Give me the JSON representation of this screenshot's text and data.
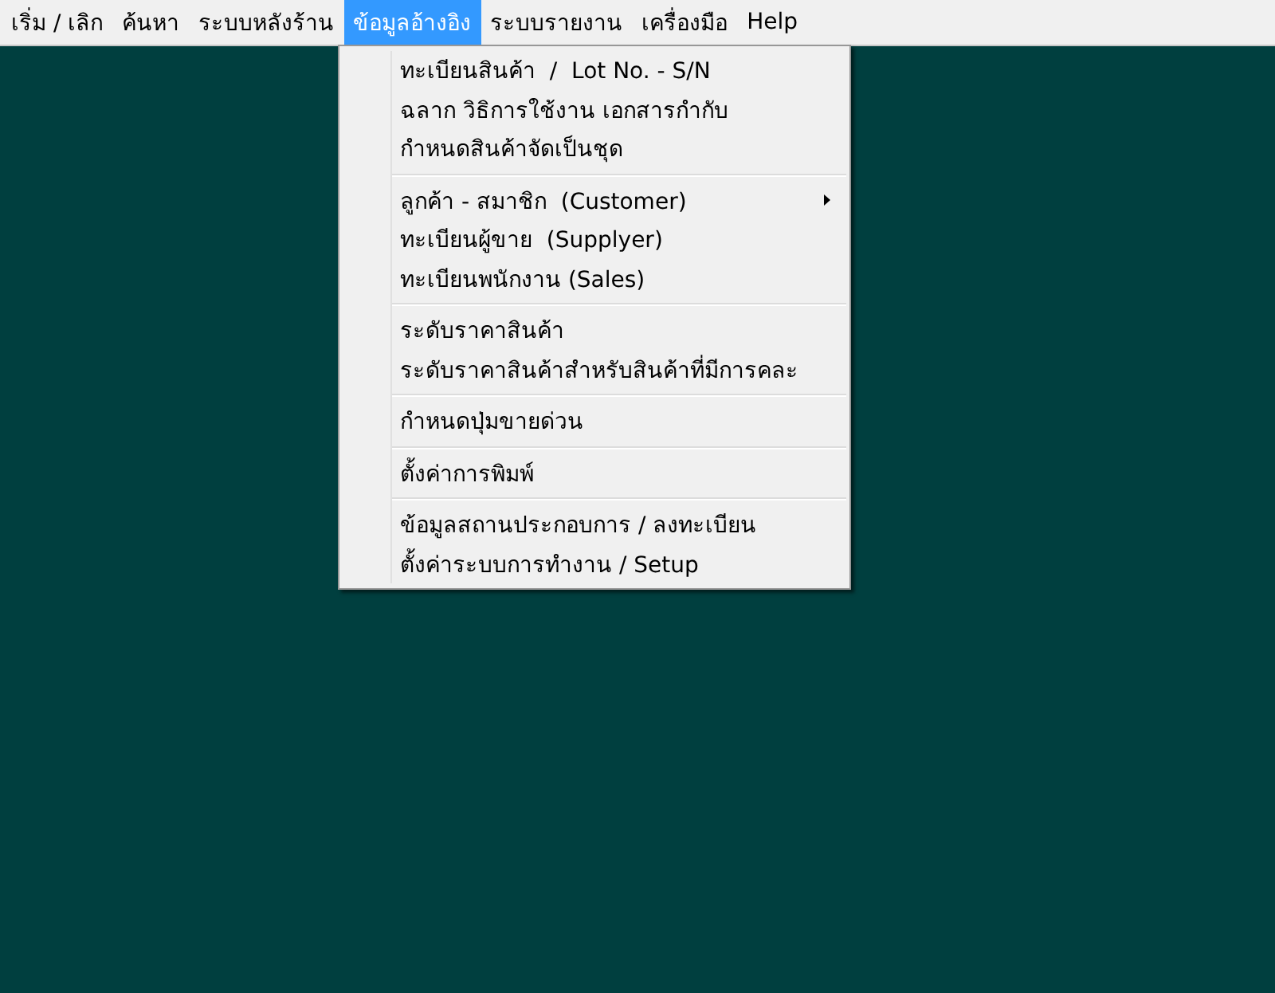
{
  "menu_bar": [
    {
      "label": "เริ่ม / เลิก",
      "selected": false
    },
    {
      "label": "ค้นหา",
      "selected": false
    },
    {
      "label": "ระบบหลังร้าน",
      "selected": false
    },
    {
      "label": "ข้อมูลอ้างอิง",
      "selected": true
    },
    {
      "label": "ระบบรายงาน",
      "selected": false
    },
    {
      "label": "เครื่องมือ",
      "selected": false
    },
    {
      "label": "Help",
      "selected": false
    }
  ],
  "dropdown": {
    "groups": [
      [
        {
          "label": "ทะเบียนสินค้า  /  Lot No. - S/N",
          "submenu": false
        },
        {
          "label": "ฉลาก วิธิการใช้งาน เอกสารกำกับ",
          "submenu": false
        },
        {
          "label": "กำหนดสินค้าจัดเป็นชุด",
          "submenu": false
        }
      ],
      [
        {
          "label": "ลูกค้า - สมาชิก  (Customer)",
          "submenu": true
        },
        {
          "label": "ทะเบียนผู้ขาย  (Supplyer)",
          "submenu": false
        },
        {
          "label": "ทะเบียนพนักงาน (Sales)",
          "submenu": false
        }
      ],
      [
        {
          "label": "ระดับราคาสินค้า",
          "submenu": false
        },
        {
          "label": "ระดับราคาสินค้าสำหรับสินค้าที่มีการคละ",
          "submenu": false
        }
      ],
      [
        {
          "label": "กำหนดปุ่มขายด่วน",
          "submenu": false
        }
      ],
      [
        {
          "label": "ตั้งค่าการพิมพ์",
          "submenu": false
        }
      ],
      [
        {
          "label": "ข้อมูลสถานประกอบการ / ลงทะเบียน",
          "submenu": false
        },
        {
          "label": "ตั้งค่าระบบการทำงาน / Setup",
          "submenu": false
        }
      ]
    ]
  }
}
